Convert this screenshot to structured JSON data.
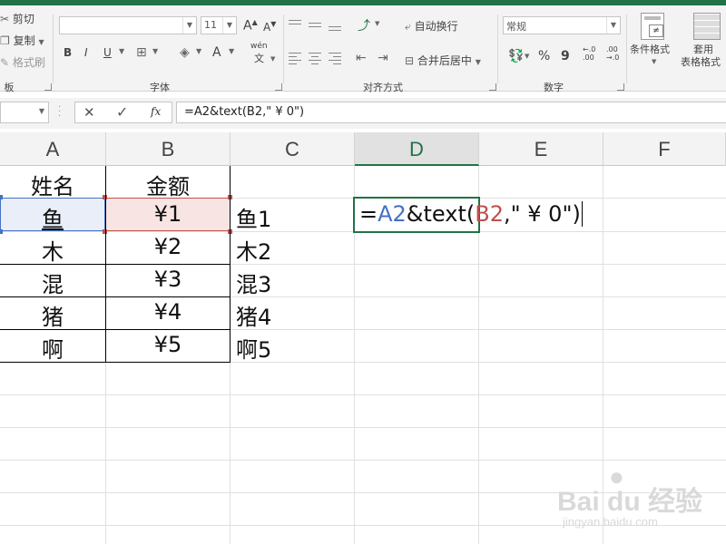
{
  "ribbon": {
    "clipboard": {
      "cut": "剪切",
      "copy": "复制",
      "format_painter": "格式刷",
      "group_label": "板"
    },
    "font": {
      "font_name": "",
      "font_size": "11",
      "bold": "B",
      "italic": "I",
      "underline": "U",
      "grow": "A",
      "shrink": "A",
      "phonetic": "wén",
      "group_label": "字体"
    },
    "alignment": {
      "wrap_text": "自动换行",
      "merge_center": "合并后居中",
      "group_label": "对齐方式"
    },
    "number": {
      "format": "常规",
      "percent": "%",
      "comma": "9",
      "inc_decimal": "←.0\n.00",
      "dec_decimal": ".00\n→.0",
      "group_label": "数字"
    },
    "styles": {
      "conditional_format": "条件格式",
      "table_format_line1": "套用",
      "table_format_line2": "表格格式"
    }
  },
  "formula_bar": {
    "name_box": "",
    "cancel": "✕",
    "enter": "✓",
    "fx": "fx",
    "formula": "=A2&text(B2,\" ¥ 0\")"
  },
  "columns": [
    "A",
    "B",
    "C",
    "D",
    "E",
    "F"
  ],
  "rows": [
    {
      "a": "姓名",
      "b": "金额",
      "c": ""
    },
    {
      "a": "鱼",
      "b": "¥1",
      "c": "鱼1"
    },
    {
      "a": "木",
      "b": "¥2",
      "c": "木2"
    },
    {
      "a": "混",
      "b": "¥3",
      "c": "混3"
    },
    {
      "a": "猪",
      "b": "¥4",
      "c": "猪4"
    },
    {
      "a": "啊",
      "b": "¥5",
      "c": "啊5"
    }
  ],
  "edit_cell": {
    "eq": "=",
    "ref1": "A2",
    "mid": "&text(",
    "ref2": "B2",
    "tail": ",\" ¥ 0\")"
  },
  "colors": {
    "accent": "#217346",
    "ref1": "#4472c4",
    "ref2": "#c0504d"
  },
  "watermark": {
    "brand": "Bai du 经验",
    "url": "jingyan.baidu.com"
  }
}
